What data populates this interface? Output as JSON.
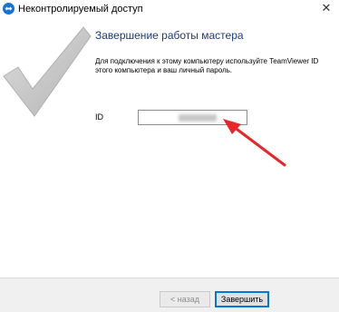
{
  "window": {
    "title": "Неконтролируемый доступ",
    "close_glyph": "✕"
  },
  "wizard": {
    "heading": "Завершение работы мастера",
    "description": "Для подключения к этому компьютеру используйте TeamViewer ID этого компьютера и ваш личный пароль.",
    "id_label": "ID",
    "id_value_state": "blurred"
  },
  "footer": {
    "back_label": "< назад",
    "finish_label": "Завершить"
  },
  "colors": {
    "heading": "#1b3c7e",
    "accent": "#0078d7",
    "arrow": "#e8262a",
    "checkmark": "#c6c6c6"
  }
}
